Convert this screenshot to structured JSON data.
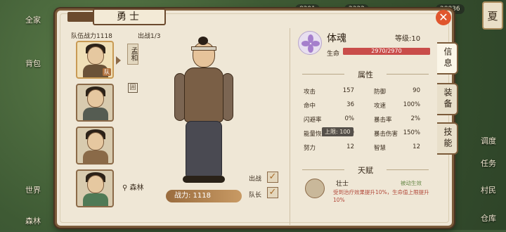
{
  "top_bar": {
    "res1": "8291",
    "res2": "2322",
    "res3": "28836"
  },
  "left_side": {
    "btn1": "全家",
    "btn2": "背包",
    "btn3": "世界",
    "btn4": "森林"
  },
  "season": "夏",
  "right_side": {
    "btn1": "调度",
    "btn2": "任务",
    "btn3": "村民",
    "btn4": "仓库"
  },
  "header": {
    "title": "勇士",
    "close_icon": "close-icon"
  },
  "team": {
    "power_label": "队伍战力1118",
    "deploy_label": "出战1/3"
  },
  "roster": [
    {
      "tag": "队"
    },
    {
      "tag": ""
    },
    {
      "tag": ""
    },
    {
      "tag": ""
    }
  ],
  "character": {
    "name": "孟和",
    "location": "森林",
    "power": "战力: 1118"
  },
  "checks": {
    "deploy": "出战",
    "leader": "队长"
  },
  "soul": {
    "name": "体魂",
    "level": "等级:10",
    "hp_label": "生命",
    "hp_text": "2970/2970",
    "hp_fraction": 1.0
  },
  "attributes": {
    "title": "属性",
    "rows": [
      {
        "l1": "攻击",
        "v1": "157",
        "l2": "防御",
        "v2": "90"
      },
      {
        "l1": "命中",
        "v1": "36",
        "l2": "攻速",
        "v2": "100%"
      },
      {
        "l1": "闪避率",
        "v1": "0%",
        "l2": "暴击率",
        "v2": "2%"
      },
      {
        "l1": "能量恢复",
        "v1": "0",
        "l2": "暴击伤害",
        "v2": "150%"
      },
      {
        "l1": "努力",
        "v1": "12",
        "l2": "智慧",
        "v2": "12"
      }
    ],
    "tooltip": "上限: 100"
  },
  "talent": {
    "title": "天赋",
    "name": "壮士",
    "tag": "被动生效",
    "desc": "受到治疗效果提升10%，生命值上限提升10%"
  },
  "tabs": [
    "信息",
    "装备",
    "技能"
  ],
  "colors": {
    "panel_bg": "#efe7d6",
    "frame": "#7b5b3a",
    "accent": "#c94d4a"
  }
}
